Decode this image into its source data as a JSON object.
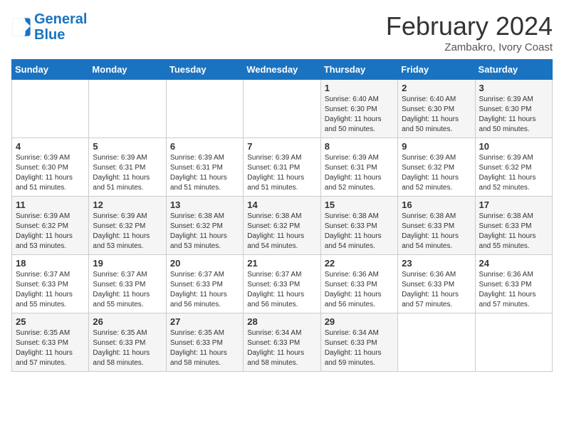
{
  "header": {
    "logo_line1": "General",
    "logo_line2": "Blue",
    "title": "February 2024",
    "subtitle": "Zambakro, Ivory Coast"
  },
  "weekdays": [
    "Sunday",
    "Monday",
    "Tuesday",
    "Wednesday",
    "Thursday",
    "Friday",
    "Saturday"
  ],
  "weeks": [
    [
      {
        "day": "",
        "info": ""
      },
      {
        "day": "",
        "info": ""
      },
      {
        "day": "",
        "info": ""
      },
      {
        "day": "",
        "info": ""
      },
      {
        "day": "1",
        "info": "Sunrise: 6:40 AM\nSunset: 6:30 PM\nDaylight: 11 hours and 50 minutes."
      },
      {
        "day": "2",
        "info": "Sunrise: 6:40 AM\nSunset: 6:30 PM\nDaylight: 11 hours and 50 minutes."
      },
      {
        "day": "3",
        "info": "Sunrise: 6:39 AM\nSunset: 6:30 PM\nDaylight: 11 hours and 50 minutes."
      }
    ],
    [
      {
        "day": "4",
        "info": "Sunrise: 6:39 AM\nSunset: 6:30 PM\nDaylight: 11 hours and 51 minutes."
      },
      {
        "day": "5",
        "info": "Sunrise: 6:39 AM\nSunset: 6:31 PM\nDaylight: 11 hours and 51 minutes."
      },
      {
        "day": "6",
        "info": "Sunrise: 6:39 AM\nSunset: 6:31 PM\nDaylight: 11 hours and 51 minutes."
      },
      {
        "day": "7",
        "info": "Sunrise: 6:39 AM\nSunset: 6:31 PM\nDaylight: 11 hours and 51 minutes."
      },
      {
        "day": "8",
        "info": "Sunrise: 6:39 AM\nSunset: 6:31 PM\nDaylight: 11 hours and 52 minutes."
      },
      {
        "day": "9",
        "info": "Sunrise: 6:39 AM\nSunset: 6:32 PM\nDaylight: 11 hours and 52 minutes."
      },
      {
        "day": "10",
        "info": "Sunrise: 6:39 AM\nSunset: 6:32 PM\nDaylight: 11 hours and 52 minutes."
      }
    ],
    [
      {
        "day": "11",
        "info": "Sunrise: 6:39 AM\nSunset: 6:32 PM\nDaylight: 11 hours and 53 minutes."
      },
      {
        "day": "12",
        "info": "Sunrise: 6:39 AM\nSunset: 6:32 PM\nDaylight: 11 hours and 53 minutes."
      },
      {
        "day": "13",
        "info": "Sunrise: 6:38 AM\nSunset: 6:32 PM\nDaylight: 11 hours and 53 minutes."
      },
      {
        "day": "14",
        "info": "Sunrise: 6:38 AM\nSunset: 6:32 PM\nDaylight: 11 hours and 54 minutes."
      },
      {
        "day": "15",
        "info": "Sunrise: 6:38 AM\nSunset: 6:33 PM\nDaylight: 11 hours and 54 minutes."
      },
      {
        "day": "16",
        "info": "Sunrise: 6:38 AM\nSunset: 6:33 PM\nDaylight: 11 hours and 54 minutes."
      },
      {
        "day": "17",
        "info": "Sunrise: 6:38 AM\nSunset: 6:33 PM\nDaylight: 11 hours and 55 minutes."
      }
    ],
    [
      {
        "day": "18",
        "info": "Sunrise: 6:37 AM\nSunset: 6:33 PM\nDaylight: 11 hours and 55 minutes."
      },
      {
        "day": "19",
        "info": "Sunrise: 6:37 AM\nSunset: 6:33 PM\nDaylight: 11 hours and 55 minutes."
      },
      {
        "day": "20",
        "info": "Sunrise: 6:37 AM\nSunset: 6:33 PM\nDaylight: 11 hours and 56 minutes."
      },
      {
        "day": "21",
        "info": "Sunrise: 6:37 AM\nSunset: 6:33 PM\nDaylight: 11 hours and 56 minutes."
      },
      {
        "day": "22",
        "info": "Sunrise: 6:36 AM\nSunset: 6:33 PM\nDaylight: 11 hours and 56 minutes."
      },
      {
        "day": "23",
        "info": "Sunrise: 6:36 AM\nSunset: 6:33 PM\nDaylight: 11 hours and 57 minutes."
      },
      {
        "day": "24",
        "info": "Sunrise: 6:36 AM\nSunset: 6:33 PM\nDaylight: 11 hours and 57 minutes."
      }
    ],
    [
      {
        "day": "25",
        "info": "Sunrise: 6:35 AM\nSunset: 6:33 PM\nDaylight: 11 hours and 57 minutes."
      },
      {
        "day": "26",
        "info": "Sunrise: 6:35 AM\nSunset: 6:33 PM\nDaylight: 11 hours and 58 minutes."
      },
      {
        "day": "27",
        "info": "Sunrise: 6:35 AM\nSunset: 6:33 PM\nDaylight: 11 hours and 58 minutes."
      },
      {
        "day": "28",
        "info": "Sunrise: 6:34 AM\nSunset: 6:33 PM\nDaylight: 11 hours and 58 minutes."
      },
      {
        "day": "29",
        "info": "Sunrise: 6:34 AM\nSunset: 6:33 PM\nDaylight: 11 hours and 59 minutes."
      },
      {
        "day": "",
        "info": ""
      },
      {
        "day": "",
        "info": ""
      }
    ]
  ]
}
